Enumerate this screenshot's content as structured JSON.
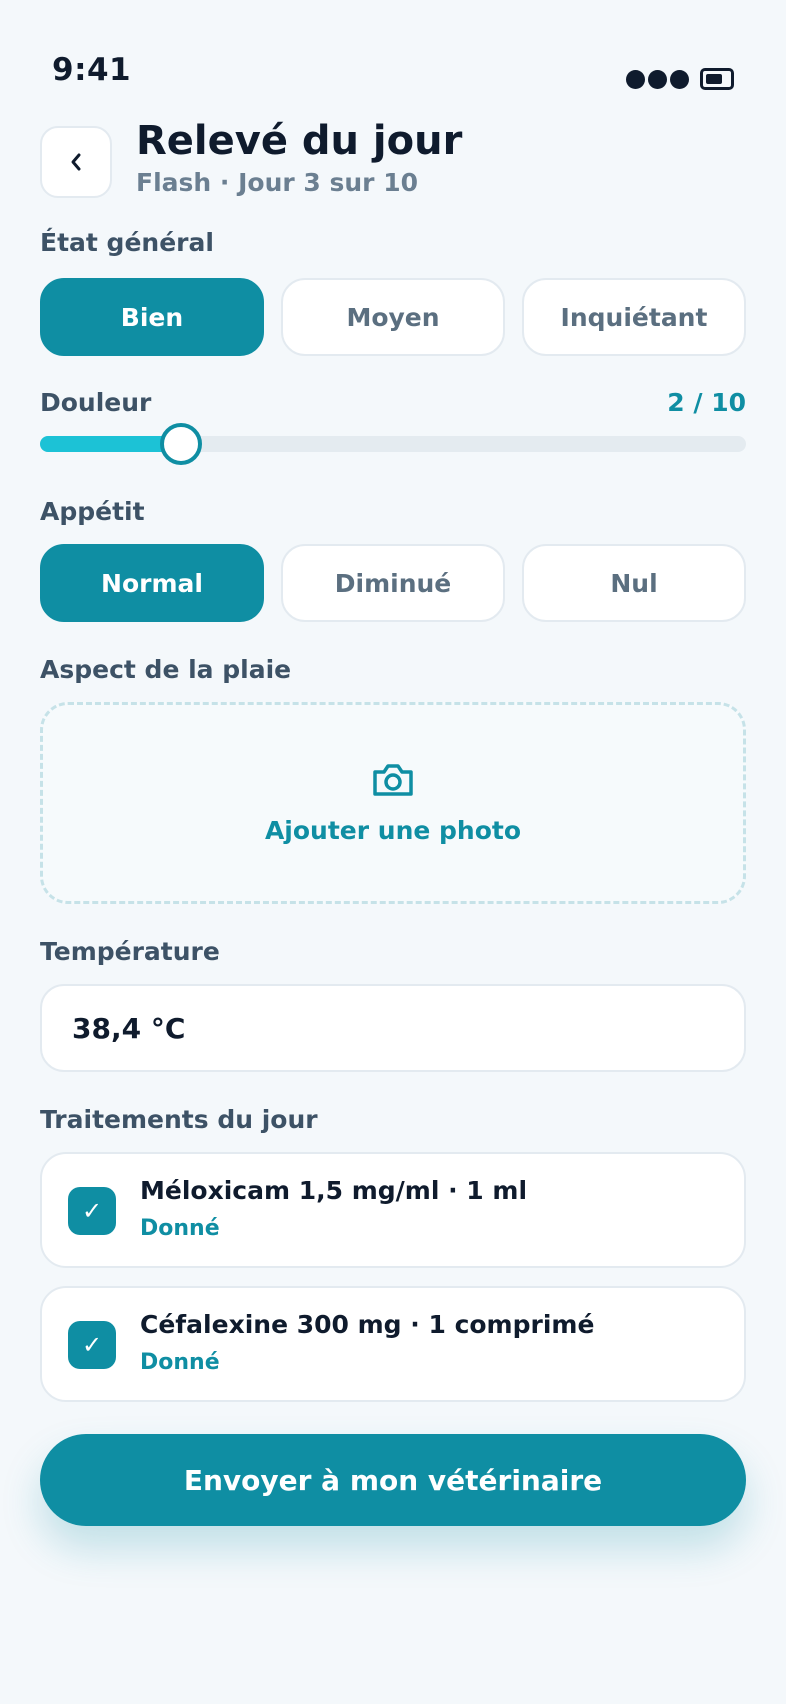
{
  "status_bar": {
    "time": "9:41"
  },
  "header": {
    "back_label": "‹",
    "title": "Relevé du jour",
    "subtitle": "Flash · Jour 3 sur 10"
  },
  "general_state": {
    "label": "État général",
    "options": [
      "Bien",
      "Moyen",
      "Inquiétant"
    ],
    "selected": "Bien"
  },
  "pain": {
    "label": "Douleur",
    "value_text": "2 / 10",
    "value": 2,
    "max": 10
  },
  "appetite": {
    "label": "Appétit",
    "options": [
      "Normal",
      "Diminué",
      "Nul"
    ],
    "selected": "Normal"
  },
  "wound": {
    "label": "Aspect de la plaie",
    "add_photo_label": "Ajouter une photo",
    "icon": "camera-icon"
  },
  "temperature": {
    "label": "Température",
    "value": "38,4 °C"
  },
  "treatments": {
    "label": "Traitements du jour",
    "items": [
      {
        "name": "Méloxicam 1,5 mg/ml · 1 ml",
        "status": "Donné",
        "checked": true
      },
      {
        "name": "Céfalexine 300 mg · 1 comprimé",
        "status": "Donné",
        "checked": true
      }
    ]
  },
  "submit_label": "Envoyer à mon vétérinaire",
  "colors": {
    "accent": "#0f8ea3",
    "slider_fill": "#1cc2d6",
    "background": "#f4f8fb"
  }
}
